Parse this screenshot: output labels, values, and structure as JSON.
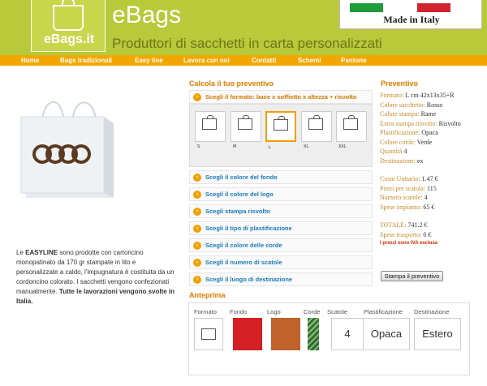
{
  "header": {
    "logo_text": "eBags.it",
    "brand": "eBags",
    "tagline": "Produttori di sacchetti in carta personalizzati",
    "made_in": "Made in Italy",
    "flag_colors": [
      "#1f9b3a",
      "#ffffff",
      "#d1242f"
    ]
  },
  "nav": [
    "Home",
    "Bags tradizionali",
    "Easy line",
    "Lavora con noi",
    "Contatti",
    "Schemi",
    "Pantone"
  ],
  "description": {
    "p1": "Le ",
    "easyline": "EASYLINE",
    "p2": " sono prodotte con cartoncino monopatinato da 170 gr stampate in lito e personalizzate a caldo, l'impugnatura è costituita da un cordoncino colorato. I sacchetti vengono confezionati manualmente. ",
    "bold": "Tutte le lavorazioni vengono svolte in Italia."
  },
  "configurator": {
    "title": "Calcola il tuo preventivo",
    "open_step": "Scegli il formato: base x soffietto x altezza + risvolto",
    "formats": [
      "S",
      "M",
      "L",
      "XL",
      "XXL"
    ],
    "selected_format": "L",
    "steps": [
      "Scegli il colore del fondo",
      "Scegli il colore del logo",
      "Scegli stampa risvolto",
      "Scegli il tipo di plastificazione",
      "Scegli il colore delle corde",
      "Scegli il numero di scatole",
      "Scegli il luogo di destinazione"
    ]
  },
  "quote": {
    "title": "Preventivo",
    "rows": [
      {
        "k": "Formato:",
        "v": "L cm 42x13x35+R"
      },
      {
        "k": "Colore sacchetto:",
        "v": "Rosso"
      },
      {
        "k": "Colore stampa:",
        "v": "Rame"
      },
      {
        "k": "Extra stampa risvolto:",
        "v": "Risvolto"
      },
      {
        "k": "Plastificazione:",
        "v": "Opaca"
      },
      {
        "k": "Colore corde:",
        "v": "Verde"
      },
      {
        "k": "Quantità",
        "v": "4"
      },
      {
        "k": "Destinazione:",
        "v": "ex"
      }
    ],
    "costs": [
      {
        "k": "Costo Unitario:",
        "v": "1.47 €"
      },
      {
        "k": "Pezzi per scatola:",
        "v": "115"
      },
      {
        "k": "Numero scatole:",
        "v": "4"
      },
      {
        "k": "Spese impianto:",
        "v": "65 €"
      }
    ],
    "totals": [
      {
        "k": "TOTALE:",
        "v": "741.2 €"
      },
      {
        "k": "Spese trasporto:",
        "v": "0 €"
      }
    ],
    "note": "I prezzi sono IVA esclusa",
    "print_button": "Stampa il preventivo"
  },
  "preview": {
    "title": "Anteprima",
    "headers": [
      "Formato",
      "Fondo",
      "Logo",
      "Corde",
      "Scatole",
      "Plastificazione",
      "Destinazione"
    ],
    "fondo_color": "#d41f24",
    "logo_color": "#c0622b",
    "corde_color": "#2f6e3a",
    "scatole": "4",
    "plastificazione": "Opaca",
    "destinazione": "Estero"
  }
}
